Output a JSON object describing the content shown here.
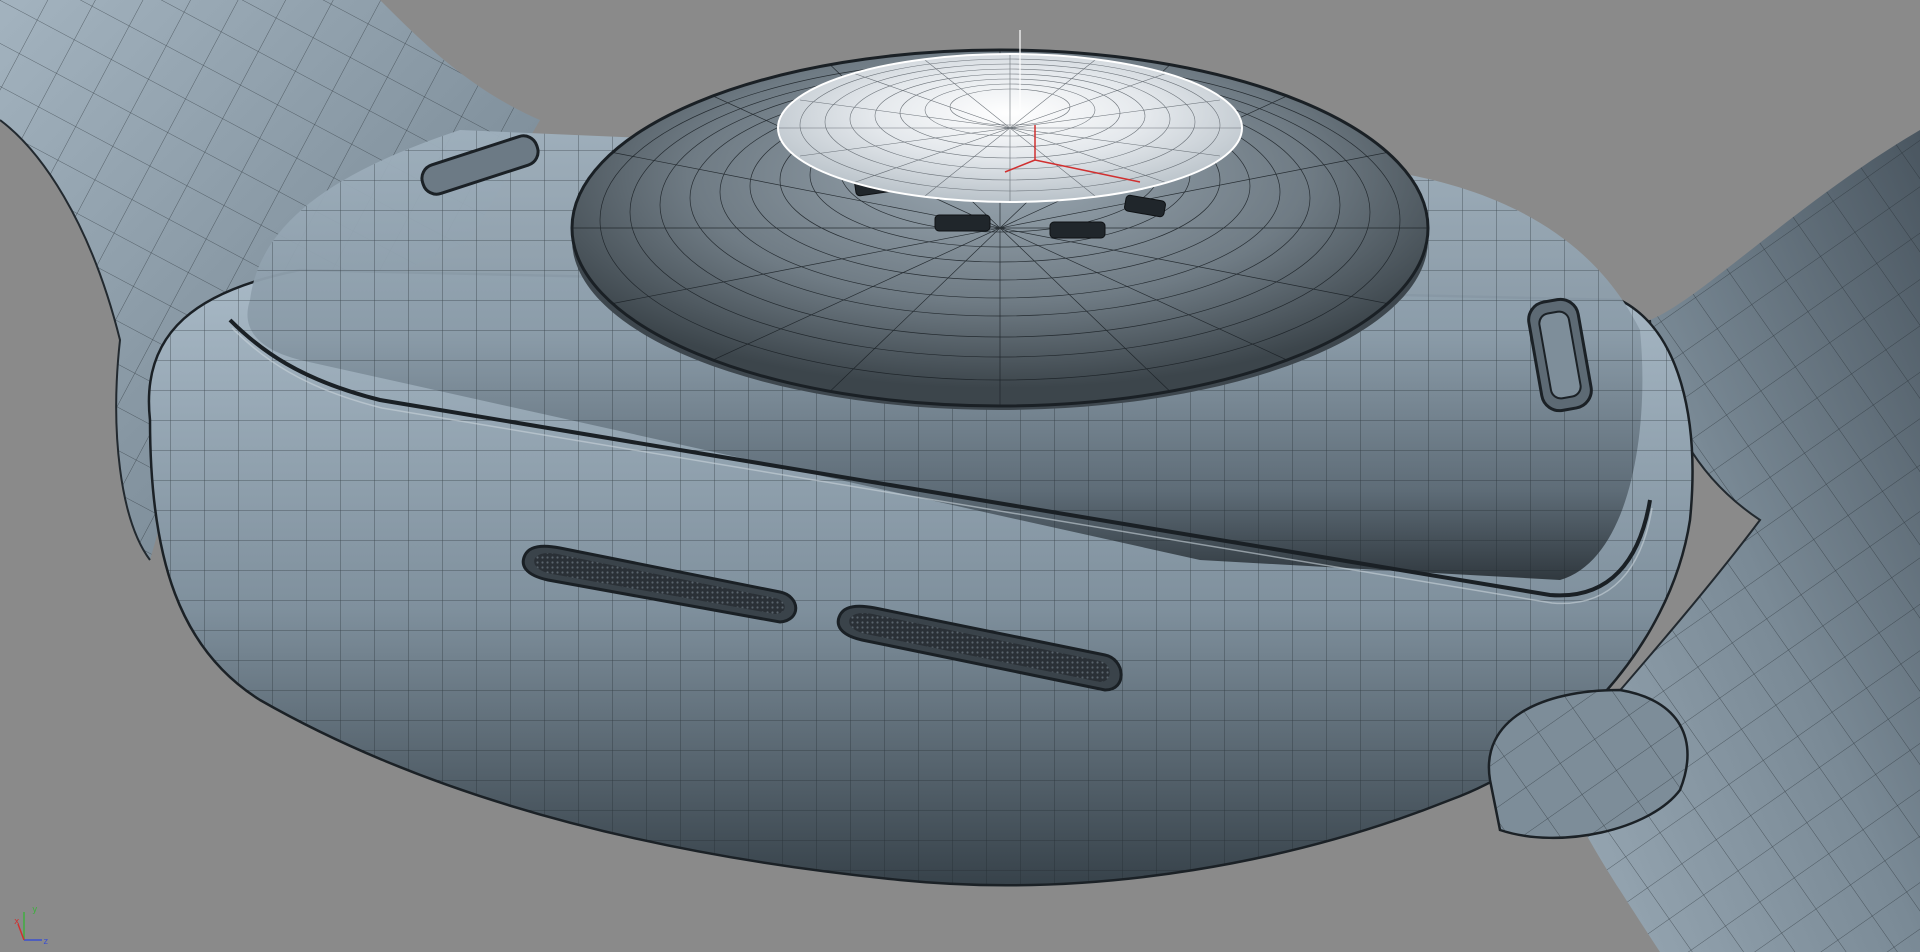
{
  "viewport": {
    "background": "#8a8a8a",
    "shading": "smooth-shaded-with-wireframe",
    "model_color": "#8fa0ad",
    "wire_color": "#1f262c",
    "selected_wire_color": "#ffffff"
  },
  "axis_gizmo": {
    "x": {
      "label": "x",
      "color": "#d03030"
    },
    "y": {
      "label": "y",
      "color": "#3fae3f"
    },
    "z": {
      "label": "z",
      "color": "#3a4fd0"
    }
  },
  "scene_objects": [
    {
      "name": "watch-body"
    },
    {
      "name": "watch-band-left"
    },
    {
      "name": "watch-band-right"
    },
    {
      "name": "sensor-dome"
    },
    {
      "name": "sensor-lens"
    },
    {
      "name": "speaker-grille"
    },
    {
      "name": "speaker-grille"
    },
    {
      "name": "band-release-button"
    },
    {
      "name": "band-release-button"
    }
  ]
}
